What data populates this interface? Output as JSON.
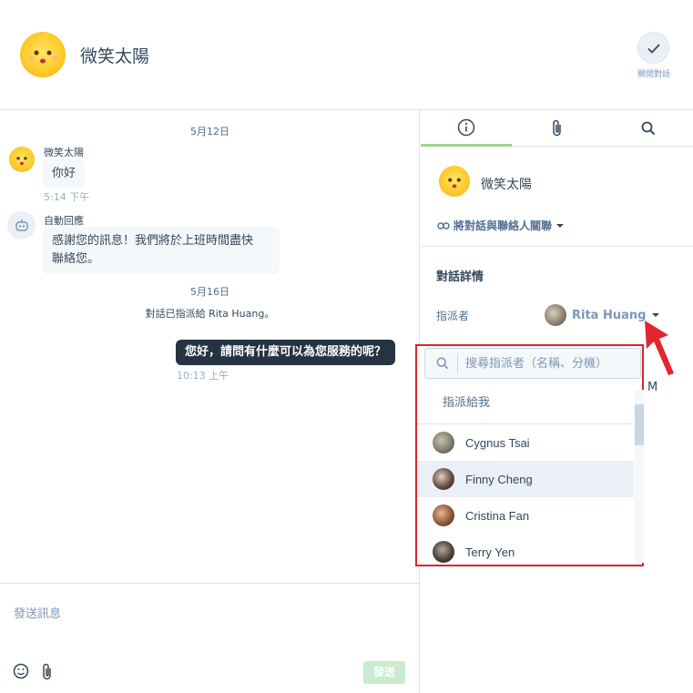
{
  "header": {
    "contact_name": "微笑太陽",
    "close_label": "關閉對話"
  },
  "thread": {
    "date1": "5月12日",
    "msg1": {
      "sender": "微笑太陽",
      "text": "你好",
      "time": "5:14 下午"
    },
    "msg2": {
      "sender": "自動回應",
      "line1": "感謝您的訊息！我們將於上班時間盡快",
      "line2": "聯絡您。"
    },
    "date2": "5月16日",
    "system": "對話已指派給 Rita Huang。",
    "outgoing": {
      "text": "您好，請問有什麼可以為您服務的呢？",
      "time": "10:13 上午"
    }
  },
  "composer": {
    "placeholder": "發送訊息",
    "send_label": "發送"
  },
  "sidebar": {
    "contact_name": "微笑太陽",
    "link_contact": "將對話與聯絡人關聯",
    "section_title": "對話詳情",
    "assignee_label": "指派者",
    "assignee_value": "Rita Huang",
    "partial_text": "M"
  },
  "dropdown": {
    "search_placeholder": "搜尋指派者（名稱、分機）",
    "assign_to_me": "指派給我",
    "items": [
      {
        "name": "Cygnus Tsai"
      },
      {
        "name": "Finny Cheng"
      },
      {
        "name": "Cristina Fan"
      },
      {
        "name": "Terry Yen"
      }
    ]
  }
}
